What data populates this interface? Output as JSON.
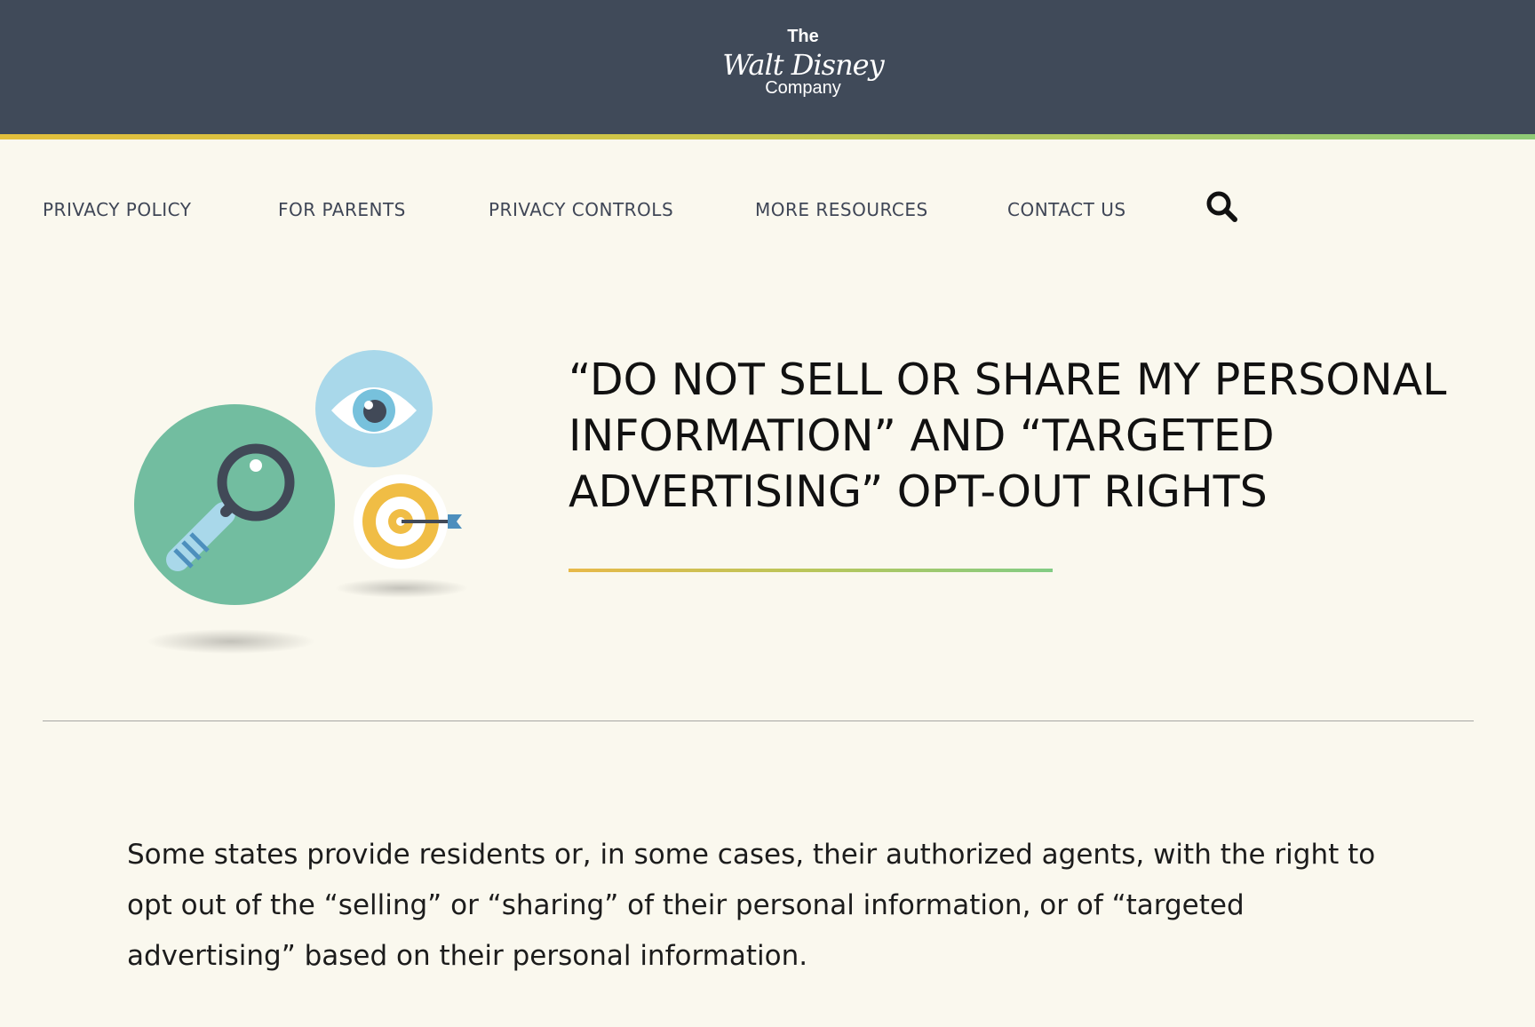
{
  "header": {
    "logo": {
      "the": "The",
      "wordmark": "Walt Disney",
      "company": "Company"
    },
    "colors": {
      "background": "#404a59",
      "stripe_start": "#e3bf3c",
      "stripe_end": "#8fcb77"
    }
  },
  "nav": {
    "items": [
      {
        "label": "PRIVACY POLICY"
      },
      {
        "label": "FOR PARENTS"
      },
      {
        "label": "PRIVACY CONTROLS"
      },
      {
        "label": "MORE RESOURCES"
      },
      {
        "label": "CONTACT US"
      }
    ],
    "search_icon": "search-icon"
  },
  "hero": {
    "illustration_icons": [
      "magnifying-glass-icon",
      "eye-icon",
      "target-icon"
    ],
    "title": "“DO NOT SELL OR SHARE MY PERSONAL INFORMATION” AND “TARGETED ADVERTISING” OPT-OUT RIGHTS"
  },
  "content": {
    "intro": "Some states provide residents or, in some cases, their authorized agents, with the right to opt out of the “selling” or “sharing” of their personal information, or of “targeted advertising” based on their personal information."
  },
  "colors": {
    "page_background": "#faf8ee",
    "nav_text": "#3f4656",
    "green_circle": "#72bda0",
    "blue_circle": "#a9d8ea",
    "target_yellow": "#f0bd45"
  }
}
